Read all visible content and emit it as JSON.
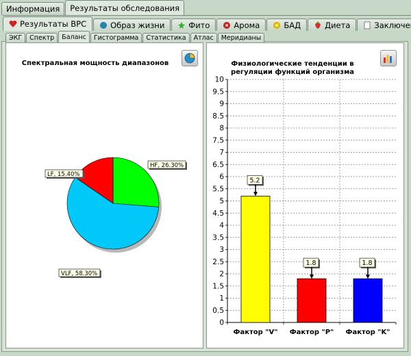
{
  "top_tabs": [
    "Информация",
    "Результаты обследования"
  ],
  "section_tabs": [
    {
      "label": "Результаты ВРС",
      "icon": "heart-icon",
      "color": "#d02020"
    },
    {
      "label": "Образ жизни",
      "icon": "globe-icon",
      "color": "#2080c0"
    },
    {
      "label": "Фито",
      "icon": "leaf-icon",
      "color": "#30b030"
    },
    {
      "label": "Арома",
      "icon": "flower-icon",
      "color": "#c02040"
    },
    {
      "label": "БАД",
      "icon": "sun-icon",
      "color": "#e0b000"
    },
    {
      "label": "Диета",
      "icon": "strawberry-icon",
      "color": "#d03030"
    },
    {
      "label": "Заключение",
      "icon": "document-icon",
      "color": "#ffffff"
    }
  ],
  "sub_tabs": [
    "ЭКГ",
    "Спектр",
    "Баланс",
    "Гистограмма",
    "Статистика",
    "Атлас",
    "Меридианы"
  ],
  "left_title": "Спектральная мощность диапазонов",
  "right_title_line1": "Физиологические тенденции в",
  "right_title_line2": "регуляции функций организма",
  "chart_data": [
    {
      "type": "pie",
      "title": "Спектральная мощность диапазонов",
      "slices": [
        {
          "label": "HF, 26.30%",
          "value": 26.3,
          "color": "#00ff00"
        },
        {
          "label": "VLF, 58.30%",
          "value": 58.3,
          "color": "#00c8f8"
        },
        {
          "label": "LF, 15.40%",
          "value": 15.4,
          "color": "#ff0000"
        }
      ]
    },
    {
      "type": "bar",
      "title": "Физиологические тенденции в регуляции функций организма",
      "categories": [
        "Фактор \"V\"",
        "Фактор \"P\"",
        "Фактор \"K\""
      ],
      "values": [
        5.2,
        1.8,
        1.8
      ],
      "value_labels": [
        "5.2",
        "1.8",
        "1.8"
      ],
      "colors": [
        "#ffff00",
        "#ff0000",
        "#0000ff"
      ],
      "ylim": [
        0,
        10
      ],
      "yticks": [
        "0",
        "0.5",
        "1",
        "1.5",
        "2",
        "2.5",
        "3",
        "3.5",
        "4",
        "4.5",
        "5",
        "5.5",
        "6",
        "6.5",
        "7",
        "7.5",
        "8",
        "8.5",
        "9",
        "9.5",
        "10"
      ],
      "grid": true
    }
  ]
}
